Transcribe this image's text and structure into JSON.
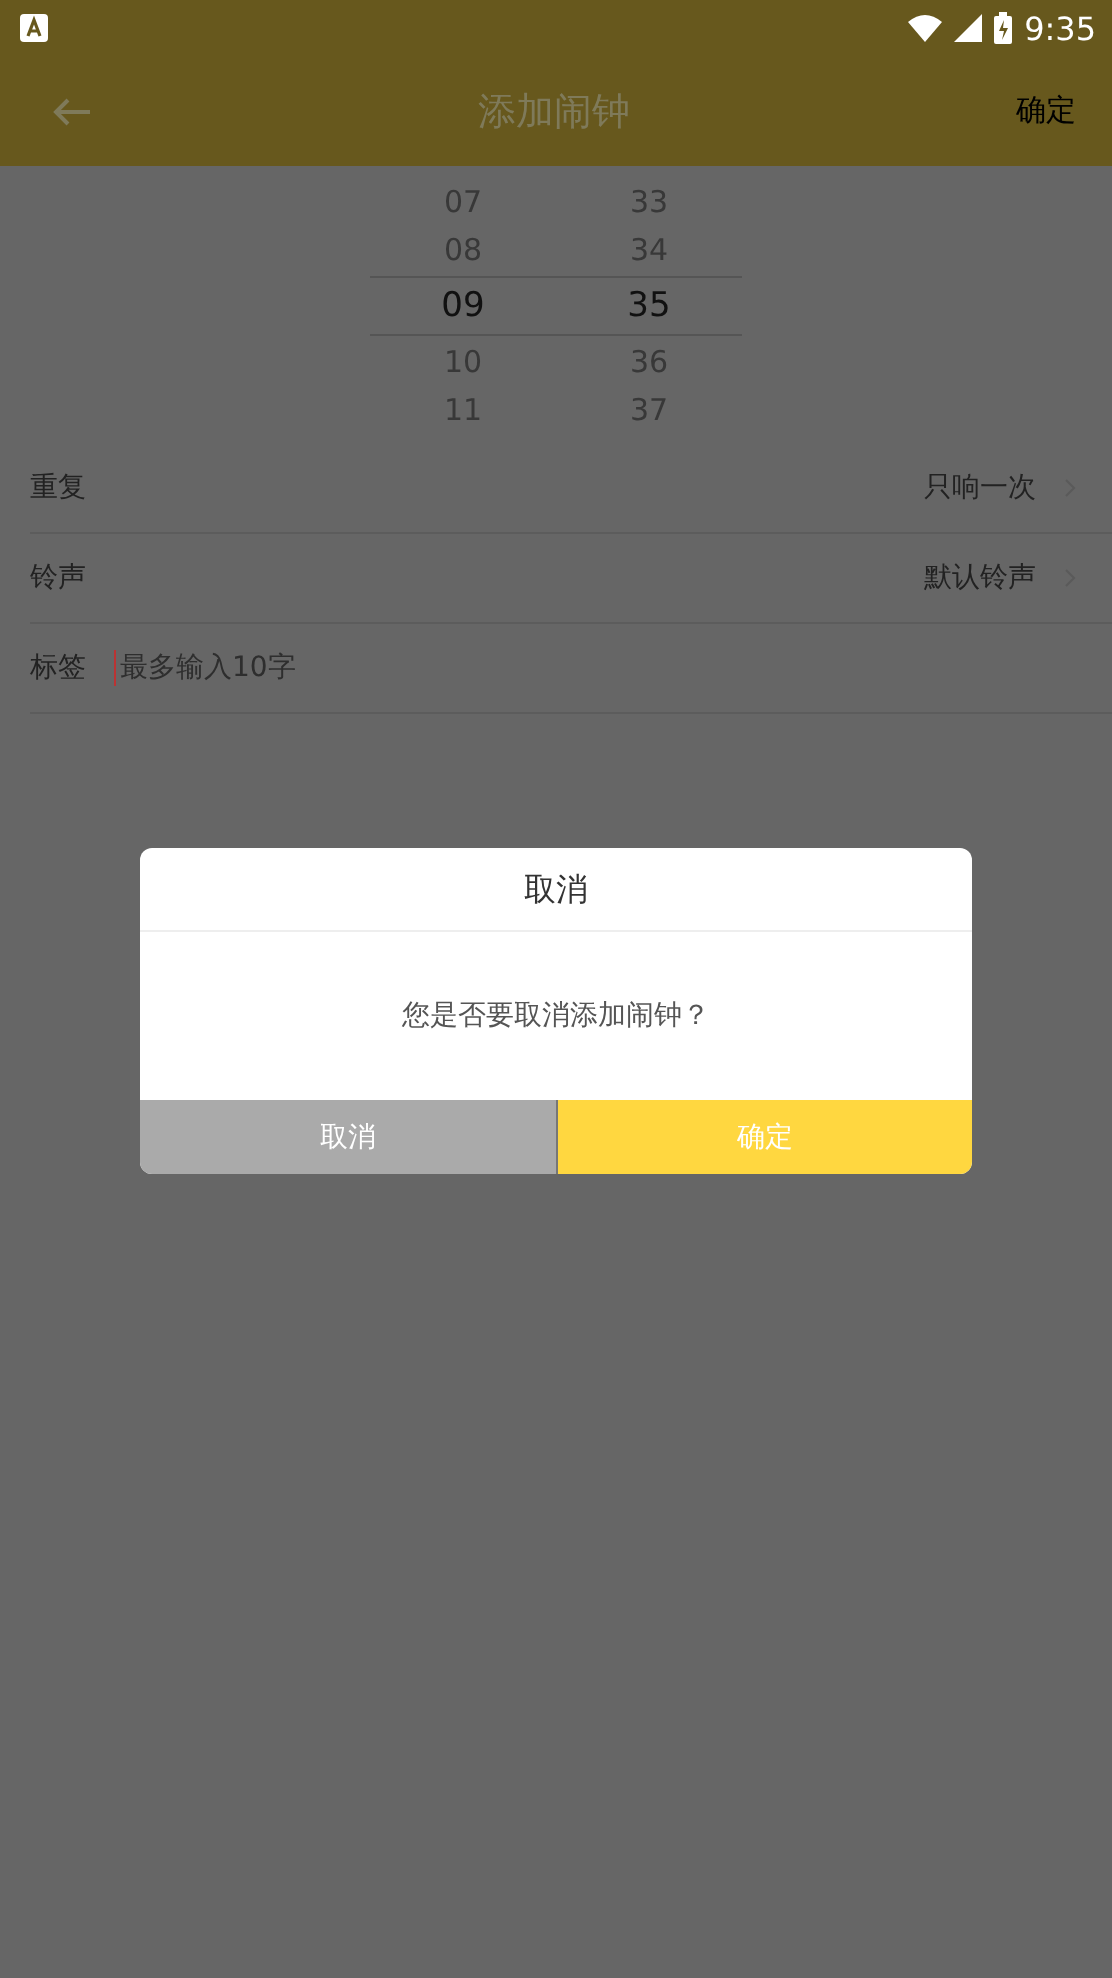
{
  "status_bar": {
    "time": "9:35"
  },
  "toolbar": {
    "title": "添加闹钟",
    "action": "确定"
  },
  "time_picker": {
    "hours": [
      {
        "label": "07",
        "selected": false
      },
      {
        "label": "08",
        "selected": false
      },
      {
        "label": "09",
        "selected": true
      },
      {
        "label": "10",
        "selected": false
      },
      {
        "label": "11",
        "selected": false
      }
    ],
    "minutes": [
      {
        "label": "33",
        "selected": false
      },
      {
        "label": "34",
        "selected": false
      },
      {
        "label": "35",
        "selected": true
      },
      {
        "label": "36",
        "selected": false
      },
      {
        "label": "37",
        "selected": false
      }
    ]
  },
  "settings": [
    {
      "kind": "select",
      "label": "重复",
      "value": "只响一次"
    },
    {
      "kind": "select",
      "label": "铃声",
      "value": "默认铃声"
    },
    {
      "kind": "input",
      "label": "标签",
      "placeholder": "最多输入10字"
    }
  ],
  "dialog": {
    "title": "取消",
    "message": "您是否要取消添加闹钟？",
    "buttons": [
      {
        "kind": "cancel",
        "label": "取消"
      },
      {
        "kind": "confirm",
        "label": "确定"
      }
    ]
  }
}
